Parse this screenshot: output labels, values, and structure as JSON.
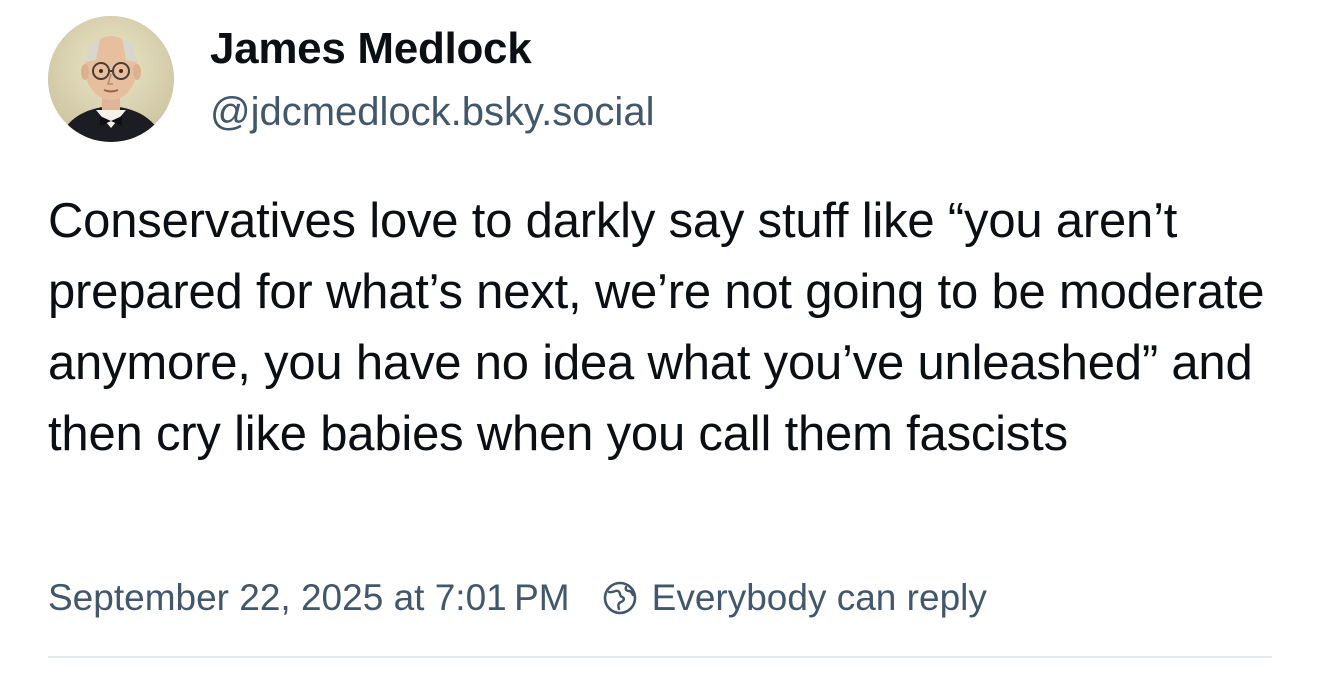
{
  "post": {
    "author": {
      "display_name": "James Medlock",
      "handle": "@jdcmedlock.bsky.social"
    },
    "text": "Conservatives love to darkly say stuff like “you aren’t prepared for what’s next, we’re not going to be moderate anymore, you have no idea what you’ve unleashed” and then cry like babies when you call them fascists",
    "timestamp": "September 22, 2025 at 7:01 PM",
    "reply_setting": "Everybody can reply"
  },
  "icons": {
    "reply_setting_icon": "globe-icon"
  },
  "colors": {
    "text_primary": "#0b0f14",
    "text_secondary": "#42576c",
    "divider": "#e5e9ee",
    "background": "#ffffff"
  }
}
